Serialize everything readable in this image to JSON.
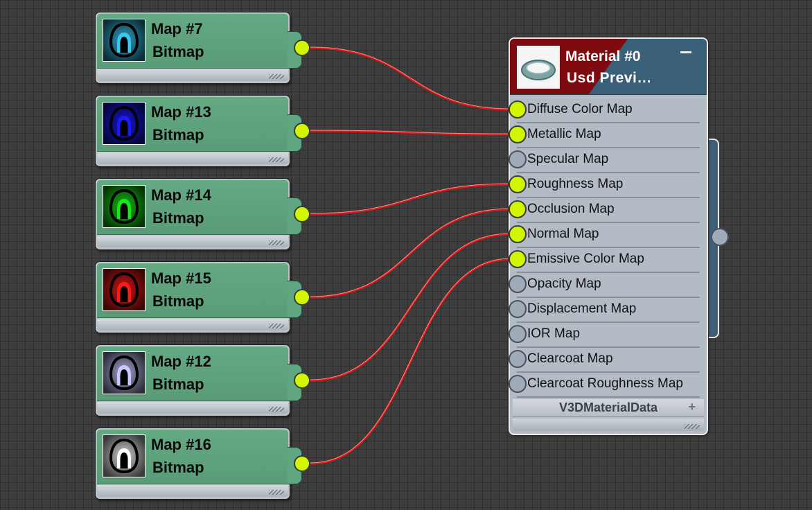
{
  "map_nodes": [
    {
      "name": "Map #7",
      "type": "Bitmap",
      "thumbnail_color": "#38c8f0",
      "target_slot": 0
    },
    {
      "name": "Map #13",
      "type": "Bitmap",
      "thumbnail_color": "#1a1aff",
      "target_slot": 1
    },
    {
      "name": "Map #14",
      "type": "Bitmap",
      "thumbnail_color": "#18e818",
      "target_slot": 3
    },
    {
      "name": "Map #15",
      "type": "Bitmap",
      "thumbnail_color": "#ff1a1a",
      "target_slot": 4
    },
    {
      "name": "Map #12",
      "type": "Bitmap",
      "thumbnail_color": "#c9c9ff",
      "target_slot": 5
    },
    {
      "name": "Map #16",
      "type": "Bitmap",
      "thumbnail_color": "#ffffff",
      "target_slot": 6
    }
  ],
  "material": {
    "title": "Material #0",
    "subtitle": "Usd  Previ…",
    "slots": [
      {
        "label": "Diffuse Color Map",
        "connected": true
      },
      {
        "label": "Metallic Map",
        "connected": true
      },
      {
        "label": "Specular Map",
        "connected": false
      },
      {
        "label": "Roughness Map",
        "connected": true
      },
      {
        "label": "Occlusion Map",
        "connected": true
      },
      {
        "label": "Normal Map",
        "connected": true
      },
      {
        "label": "Emissive Color Map",
        "connected": true
      },
      {
        "label": "Opacity Map",
        "connected": false
      },
      {
        "label": "Displacement Map",
        "connected": false
      },
      {
        "label": "IOR Map",
        "connected": false
      },
      {
        "label": "Clearcoat Map",
        "connected": false
      },
      {
        "label": "Clearcoat Roughness Map",
        "connected": false
      }
    ],
    "footer_label": "V3DMaterialData",
    "footer_plus": "+",
    "header_colors": {
      "left": "#7d0b10",
      "right": "#3a5f78"
    }
  },
  "colors": {
    "canvas": "#3d3d3d",
    "map_header": "#5fa57f",
    "socket_connected": "#d2f600",
    "socket_empty": "#9fabb8",
    "wire": "#e01818"
  }
}
